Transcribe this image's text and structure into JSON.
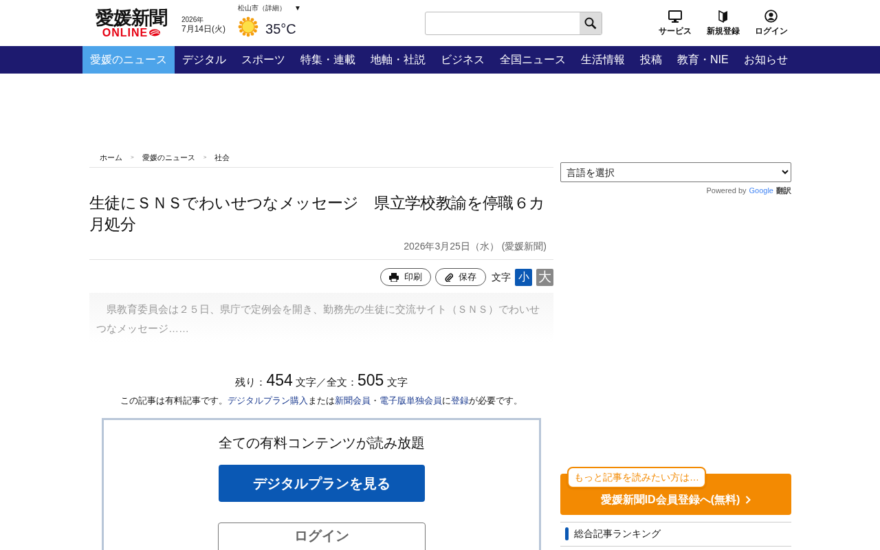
{
  "header": {
    "logo": {
      "title": "愛媛新聞",
      "subtitle": "ONLINE"
    },
    "date": {
      "year": "2026年",
      "day": "7月14日(火)"
    },
    "weather": {
      "city": "松山市（詳細）",
      "caret": "▼",
      "temperature": "35°C"
    },
    "links": [
      {
        "kind": "monitor",
        "label": "サービス"
      },
      {
        "kind": "book",
        "label": "新規登録"
      },
      {
        "kind": "user",
        "label": "ログイン"
      }
    ]
  },
  "nav": [
    {
      "label": "愛媛のニュース",
      "selected": true
    },
    {
      "label": "デジタル",
      "selected": false
    },
    {
      "label": "スポーツ",
      "selected": false
    },
    {
      "label": "特集・連載",
      "selected": false
    },
    {
      "label": "地軸・社説",
      "selected": false
    },
    {
      "label": "ビジネス",
      "selected": false
    },
    {
      "label": "全国ニュース",
      "selected": false
    },
    {
      "label": "生活情報",
      "selected": false
    },
    {
      "label": "投稿",
      "selected": false
    },
    {
      "label": "教育・NIE",
      "selected": false
    },
    {
      "label": "お知らせ",
      "selected": false
    }
  ],
  "breadcrumb": {
    "items": [
      "ホーム",
      "愛媛のニュース",
      "社会"
    ],
    "separator": ">"
  },
  "article": {
    "title": "生徒にＳＮＳでわいせつなメッセージ　県立学校教諭を停職６カ月処分",
    "dateline": "2026年3月25日（水） (愛媛新聞)",
    "tools": [
      {
        "kind": "print",
        "label": "印刷"
      },
      {
        "kind": "save",
        "label": "保存"
      }
    ],
    "font_size_label": "文字",
    "font_sizes": [
      {
        "label": "小",
        "selected": true
      },
      {
        "label": "大",
        "selected": false
      }
    ],
    "lead": "県教育委員会は２５日、県庁で定例会を開き、勤務先の生徒に交流サイト（ＳＮＳ）でわいせつなメッセージ……"
  },
  "paywall": {
    "remaining_label": "残り：",
    "remaining": "454",
    "unit": "文字／全文：",
    "total": "505",
    "total_unit": "文字",
    "notice": [
      {
        "kind": "text",
        "text": "この記事は有料記事です。"
      },
      {
        "kind": "link",
        "text": "デジタルプラン購入"
      },
      {
        "kind": "text",
        "text": "または"
      },
      {
        "kind": "link",
        "text": "新聞会員"
      },
      {
        "kind": "text",
        "text": "・"
      },
      {
        "kind": "link",
        "text": "電子版単独会員"
      },
      {
        "kind": "text",
        "text": "に"
      },
      {
        "kind": "link",
        "text": "登録"
      },
      {
        "kind": "text",
        "text": "が必要です。"
      }
    ],
    "box_title": "全ての有料コンテンツが読み放題",
    "plan_button": "デジタルプランを見る",
    "login_button": "ログイン"
  },
  "sidebar": {
    "language_select": "言語を選択",
    "powered_by": "Powered by",
    "google": "Google",
    "translate": "翻訳",
    "promo": {
      "bubble": "もっと記事を読みたい方は…",
      "button": "愛媛新聞ID会員登録へ(無料)"
    },
    "ranking_title": "総合記事ランキング"
  }
}
